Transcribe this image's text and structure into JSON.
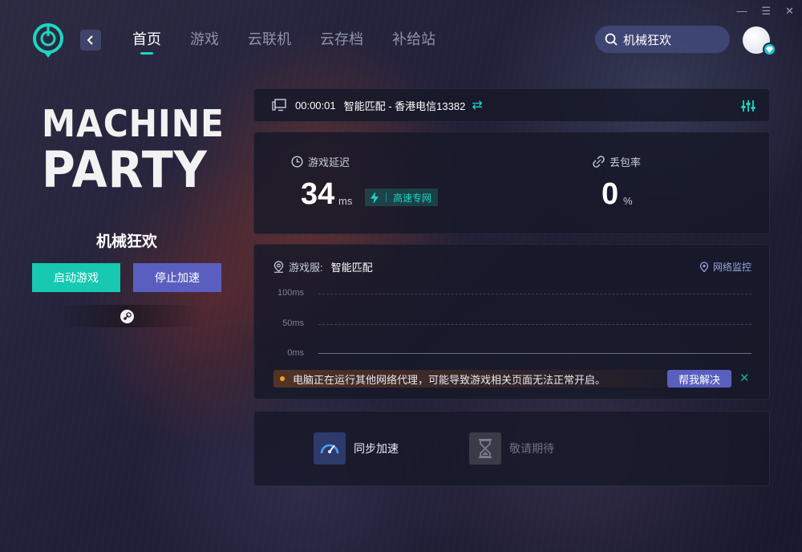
{
  "nav": {
    "items": [
      {
        "label": "首页",
        "active": true
      },
      {
        "label": "游戏",
        "active": false
      },
      {
        "label": "云联机",
        "active": false
      },
      {
        "label": "云存档",
        "active": false
      },
      {
        "label": "补给站",
        "active": false
      }
    ]
  },
  "search": {
    "value": "机械狂欢"
  },
  "window_controls": {
    "minimize": "—",
    "menu": "☰",
    "close": "✕"
  },
  "game": {
    "logo_line1": "MACHINE",
    "logo_line2": "PARTY",
    "name": "机械狂欢",
    "start_label": "启动游戏",
    "stop_label": "停止加速",
    "platform_icon": "steam-icon"
  },
  "status": {
    "elapsed": "00:00:01",
    "route": "智能匹配 - 香港电信13382",
    "swap_glyph": "⇄"
  },
  "metrics": {
    "latency_label": "游戏延迟",
    "latency_value": "34",
    "latency_unit": "ms",
    "line_tag": "高速专网",
    "loss_label": "丢包率",
    "loss_value": "0",
    "loss_unit": "%"
  },
  "chart_panel": {
    "server_label": "游戏服:",
    "server_value": "智能匹配",
    "monitor_label": "网络监控",
    "y_ticks": [
      "100ms",
      "50ms",
      "0ms"
    ],
    "warning": "电脑正在运行其他网络代理，可能导致游戏相关页面无法正常开启。",
    "help_label": "帮我解决",
    "close_glyph": "✕"
  },
  "tools": {
    "sync_label": "同步加速",
    "soon_label": "敬请期待"
  },
  "colors": {
    "accent": "#1ad6c3",
    "primary_button": "#17c9b1",
    "secondary_button": "#5a5fbf",
    "warning": "#f0a020"
  }
}
